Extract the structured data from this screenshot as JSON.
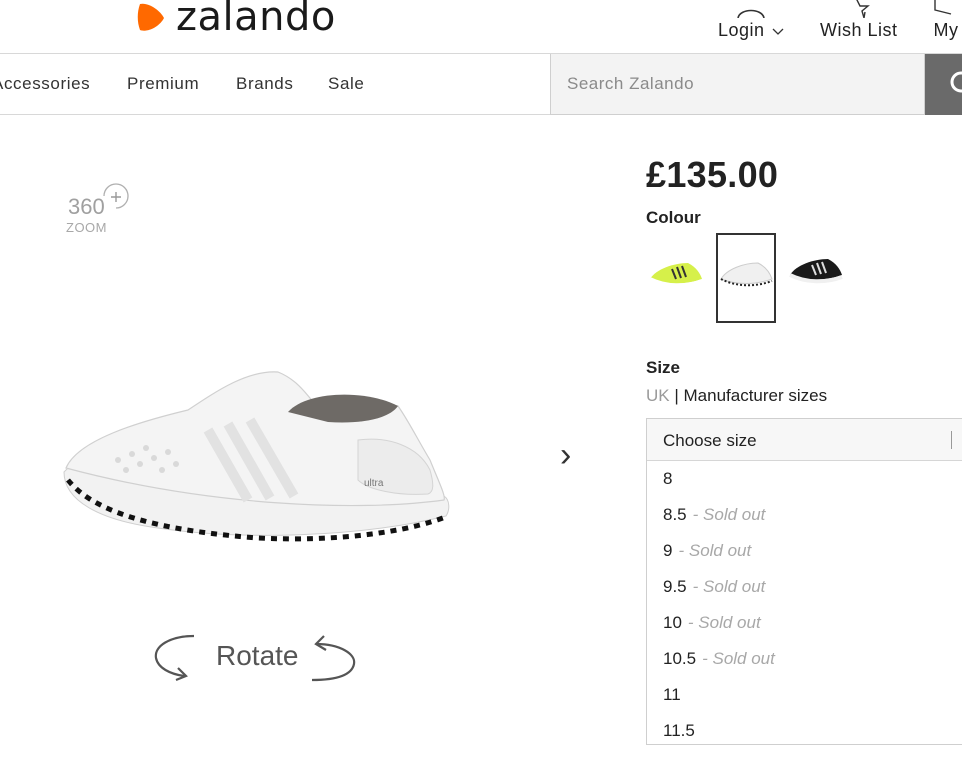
{
  "header": {
    "brand": "zalando",
    "login_label": "Login",
    "wishlist_label": "Wish List",
    "my_label": "My"
  },
  "nav": {
    "items": [
      "Accessories",
      "Premium",
      "Brands",
      "Sale"
    ]
  },
  "search": {
    "placeholder": "Search Zalando"
  },
  "product": {
    "zoom_360": "360",
    "zoom_label": "ZOOM",
    "shoe_text": "ultra",
    "next_glyph": "›",
    "rotate_label": "Rotate"
  },
  "buy": {
    "price": "£135.00",
    "colour_title": "Colour",
    "size_title": "Size",
    "size_unit_uk": "UK",
    "size_unit_sep": " | ",
    "size_unit_mfr": "Manufacturer sizes",
    "size_placeholder": "Choose size",
    "sizes": [
      {
        "size": "8",
        "status": ""
      },
      {
        "size": "8.5",
        "status": "- Sold out"
      },
      {
        "size": "9",
        "status": "- Sold out"
      },
      {
        "size": "9.5",
        "status": "- Sold out"
      },
      {
        "size": "10",
        "status": "- Sold out"
      },
      {
        "size": "10.5",
        "status": "- Sold out"
      },
      {
        "size": "11",
        "status": ""
      },
      {
        "size": "11.5",
        "status": ""
      }
    ]
  },
  "colors": {
    "brand_orange": "#ff6900",
    "search_button": "#6a6a6a",
    "sold_out": "#a8a8a8"
  }
}
